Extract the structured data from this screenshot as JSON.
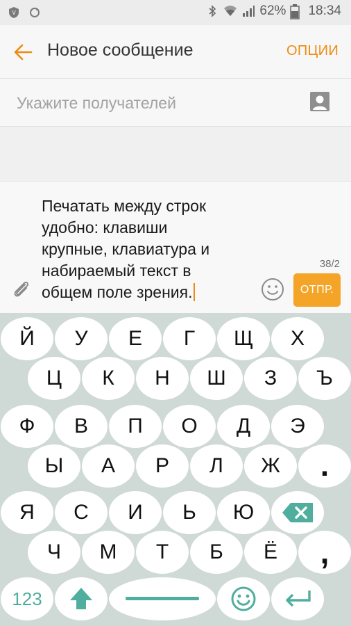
{
  "status_bar": {
    "battery": "62%",
    "time": "18:34",
    "icons": [
      "shield-icon",
      "sync-icon",
      "bluetooth-icon",
      "wifi-icon",
      "signal-icon",
      "battery-icon"
    ]
  },
  "header": {
    "title": "Новое сообщение",
    "options_label": "ОПЦИИ"
  },
  "recipients": {
    "placeholder": "Укажите получателей"
  },
  "composer": {
    "text": "Печатать между строк\nудобно: клавиши\nкрупные, клавиатура и\nнабираемый текст в\nобщем поле зрения.",
    "counter": "38/2",
    "send_label": "ОТПР."
  },
  "keyboard": {
    "rows": [
      [
        "Й",
        "У",
        "Е",
        "Г",
        "Щ",
        "Х"
      ],
      [
        "Ц",
        "К",
        "Н",
        "Ш",
        "З",
        "Ъ"
      ],
      [
        "Ф",
        "В",
        "П",
        "О",
        "Д",
        "Э"
      ],
      [
        "Ы",
        "А",
        "Р",
        "Л",
        "Ж",
        "."
      ],
      [
        "Я",
        "С",
        "И",
        "Ь",
        "Ю"
      ],
      [
        "Ч",
        "М",
        "Т",
        "Б",
        "Ё",
        ","
      ]
    ],
    "bottom": {
      "numbers_label": "123"
    },
    "accent_color": "#4fae9d"
  },
  "colors": {
    "accent": "#ee8b12",
    "send_button": "#f4a427",
    "keyboard_bg": "#cfd9d6"
  }
}
